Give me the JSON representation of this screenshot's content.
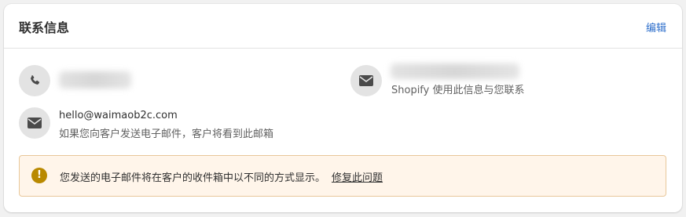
{
  "card": {
    "title": "联系信息",
    "edit_label": "编辑"
  },
  "phone": {
    "icon": "phone-icon",
    "value_blurred": true
  },
  "shop_email": {
    "icon": "mail-icon",
    "value_blurred": true,
    "caption": "Shopify 使用此信息与您联系"
  },
  "customer_email": {
    "icon": "mail-icon",
    "address": "hello@waimaob2c.com",
    "caption": "如果您向客户发送电子邮件，客户将看到此邮箱"
  },
  "warning_banner": {
    "icon": "exclamation-icon",
    "message": "您发送的电子邮件将在客户的收件箱中以不同的方式显示。",
    "link_label": "修复此问题"
  },
  "colors": {
    "link": "#2c6ecb",
    "warning_bg": "#fff5ea",
    "warning_border": "#e8c79a",
    "warning_icon": "#b98900"
  }
}
